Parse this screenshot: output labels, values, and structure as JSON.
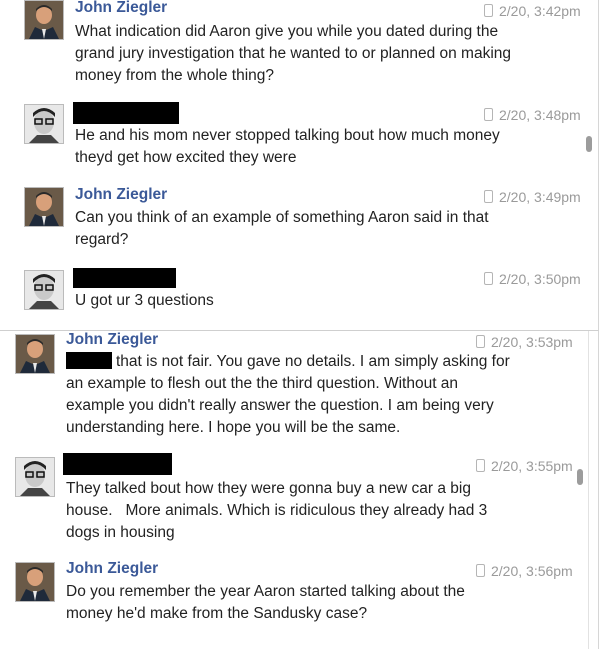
{
  "conversation_top": [
    {
      "sender": "John Ziegler",
      "avatar": "man-in-suit-avatar",
      "time": "2/20, 3:42pm",
      "lines": [
        "What indication did Aaron give you while you dated during the",
        "grand jury investigation that he wanted to or planned on making",
        "money from the whole thing?"
      ]
    },
    {
      "sender": "",
      "avatar": "man-with-glasses-avatar",
      "time": "2/20, 3:48pm",
      "lines": [
        "He and his mom never stopped talking bout how much money",
        "theyd get how excited they were"
      ]
    },
    {
      "sender": "John Ziegler",
      "avatar": "man-in-suit-avatar",
      "time": "2/20, 3:49pm",
      "lines": [
        "Can you think of an example of something Aaron said in that",
        "regard?"
      ]
    },
    {
      "sender": "",
      "avatar": "man-with-glasses-avatar",
      "time": "2/20, 3:50pm",
      "lines": [
        "U got ur 3 questions"
      ]
    }
  ],
  "conversation_bottom": [
    {
      "sender": "John Ziegler",
      "avatar": "man-in-suit-avatar",
      "time": "2/20, 3:53pm",
      "lines": [
        "that is not fair. You gave no details. I am simply asking for",
        "an example to flesh out the the third question. Without an",
        "example you didn't really answer the question. I am being very",
        "understanding here. I hope you will be the same."
      ]
    },
    {
      "sender": "",
      "avatar": "man-with-glasses-avatar",
      "time": "2/20, 3:55pm",
      "lines": [
        "They talked bout how they were gonna buy a new car a big",
        "house.   More animals. Which is ridiculous they already had 3",
        "dogs in housing"
      ]
    },
    {
      "sender": "John Ziegler",
      "avatar": "man-in-suit-avatar",
      "time": "2/20, 3:56pm",
      "lines": [
        "Do you remember the year Aaron started talking about the",
        "money he'd make from the Sandusky case?"
      ]
    }
  ],
  "colors": {
    "name": "#3b5998",
    "time": "#9a9a9a",
    "text": "#222222",
    "redaction": "#000000"
  }
}
